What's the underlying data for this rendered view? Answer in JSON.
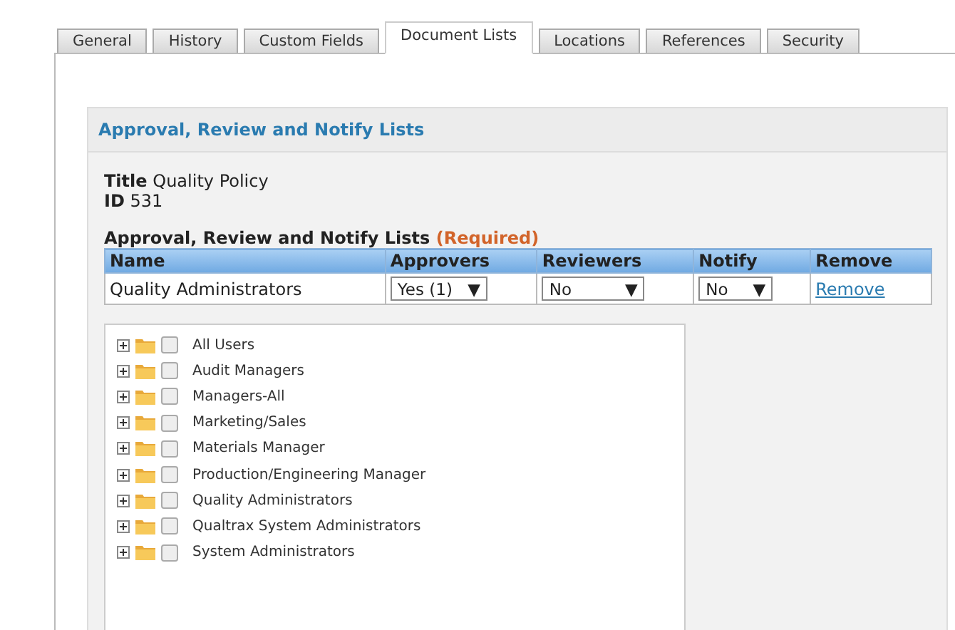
{
  "tabs": [
    {
      "label": "General",
      "selected": false
    },
    {
      "label": "History",
      "selected": false
    },
    {
      "label": "Custom Fields",
      "selected": false
    },
    {
      "label": "Document Lists",
      "selected": true
    },
    {
      "label": "Locations",
      "selected": false
    },
    {
      "label": "References",
      "selected": false
    },
    {
      "label": "Security",
      "selected": false
    }
  ],
  "panel": {
    "title": "Approval, Review and Notify Lists",
    "fields": [
      {
        "label": "Title",
        "value": "Quality Policy"
      },
      {
        "label": "ID",
        "value": "531"
      }
    ],
    "lists_heading": "Approval, Review and Notify Lists",
    "required_note": "(Required)",
    "table": {
      "columns": [
        "Name",
        "Approvers",
        "Reviewers",
        "Notify",
        "Remove"
      ],
      "rows": [
        {
          "cells": [
            {
              "kind": "text",
              "text": "Quality Administrators"
            },
            {
              "kind": "select",
              "text": "Yes (1)",
              "caret": "▼"
            },
            {
              "kind": "select",
              "text": "No",
              "caret": "▼"
            },
            {
              "kind": "select",
              "text": "No",
              "caret": "▼"
            },
            {
              "kind": "link",
              "text": "Remove"
            }
          ]
        }
      ]
    },
    "tree": [
      {
        "label": "All Users",
        "checked": false
      },
      {
        "label": "Audit Managers",
        "checked": false
      },
      {
        "label": "Managers-All",
        "checked": false
      },
      {
        "label": "Marketing/Sales",
        "checked": false
      },
      {
        "label": "Materials Manager",
        "checked": false
      },
      {
        "label": "Production/Engineering Manager",
        "checked": false
      },
      {
        "label": "Quality Administrators",
        "checked": false
      },
      {
        "label": "Qualtrax System Administrators",
        "checked": false
      },
      {
        "label": "System Administrators",
        "checked": false
      }
    ]
  }
}
